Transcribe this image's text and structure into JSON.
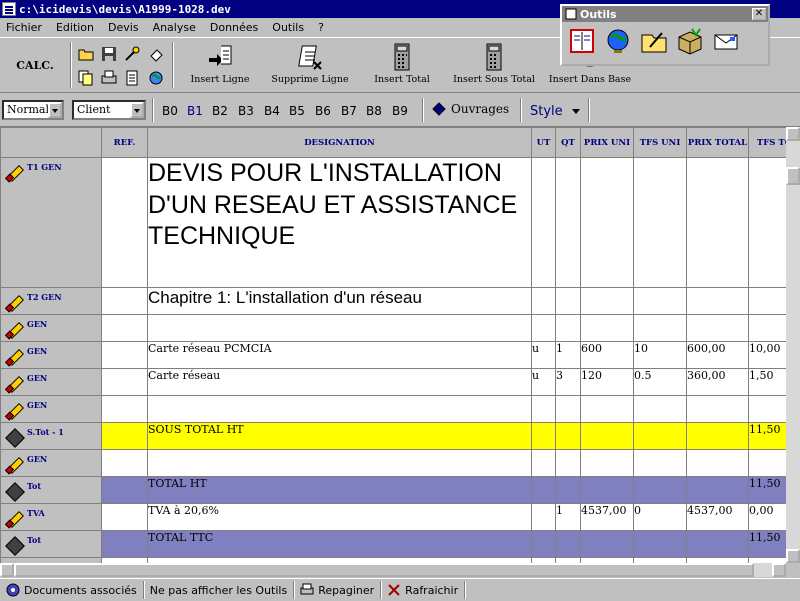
{
  "window": {
    "title": "c:\\icidevis\\devis\\A1999-1028.dev"
  },
  "menu": [
    "Fichier",
    "Edition",
    "Devis",
    "Analyse",
    "Données",
    "Outils",
    "?"
  ],
  "toolbar": {
    "calc_label": "CALC.",
    "buttons": [
      "Insert Ligne",
      "Supprime Ligne",
      "Insert Total",
      "Insert Sous Total",
      "Insert Dans Base"
    ]
  },
  "formatbar": {
    "style_value": "Normal",
    "client_value": "Client",
    "b_buttons": [
      "B0",
      "B1",
      "B2",
      "B3",
      "B4",
      "B5",
      "B6",
      "B7",
      "B8",
      "B9"
    ],
    "ouvrages_label": "Ouvrages",
    "style_label": "Style"
  },
  "columns": [
    "",
    "REF.",
    "DESIGNATION",
    "UT",
    "QT",
    "PRIX UNI",
    "TFS UNI",
    "PRIX TOTAL",
    "TFS TO"
  ],
  "rows": [
    {
      "type": "T1 GEN",
      "ref": "",
      "designation": "DEVIS POUR L'INSTALLATION D'UN RESEAU ET ASSISTANCE TECHNIQUE",
      "ut": "",
      "qt": "",
      "prix_uni": "",
      "tfs_uni": "",
      "prix_total": "",
      "tfs_total": ""
    },
    {
      "type": "T2 GEN",
      "ref": "",
      "designation": "Chapitre 1: L'installation d'un réseau",
      "ut": "",
      "qt": "",
      "prix_uni": "",
      "tfs_uni": "",
      "prix_total": "",
      "tfs_total": ""
    },
    {
      "type": "GEN",
      "ref": "",
      "designation": "",
      "ut": "",
      "qt": "",
      "prix_uni": "",
      "tfs_uni": "",
      "prix_total": "",
      "tfs_total": ""
    },
    {
      "type": "GEN",
      "ref": "",
      "designation": "Carte réseau PCMCIA",
      "ut": "u",
      "qt": "1",
      "prix_uni": "600",
      "tfs_uni": "10",
      "prix_total": "600,00",
      "tfs_total": "10,00"
    },
    {
      "type": "GEN",
      "ref": "",
      "designation": "Carte réseau",
      "ut": "u",
      "qt": "3",
      "prix_uni": "120",
      "tfs_uni": "0.5",
      "prix_total": "360,00",
      "tfs_total": "1,50"
    },
    {
      "type": "GEN",
      "ref": "",
      "designation": "",
      "ut": "",
      "qt": "",
      "prix_uni": "",
      "tfs_uni": "",
      "prix_total": "",
      "tfs_total": ""
    },
    {
      "type": "S.Tot - 1",
      "ref": "",
      "designation": "SOUS TOTAL HT",
      "ut": "",
      "qt": "",
      "prix_uni": "",
      "tfs_uni": "",
      "prix_total": "",
      "tfs_total": "11,50"
    },
    {
      "type": "GEN",
      "ref": "",
      "designation": "",
      "ut": "",
      "qt": "",
      "prix_uni": "",
      "tfs_uni": "",
      "prix_total": "",
      "tfs_total": ""
    },
    {
      "type": "Tot",
      "ref": "",
      "designation": "TOTAL HT",
      "ut": "",
      "qt": "",
      "prix_uni": "",
      "tfs_uni": "",
      "prix_total": "",
      "tfs_total": "11,50"
    },
    {
      "type": "TVA",
      "ref": "",
      "designation": "TVA à 20,6%",
      "ut": "",
      "qt": "1",
      "prix_uni": "4537,00",
      "tfs_uni": "0",
      "prix_total": "4537,00",
      "tfs_total": "0,00"
    },
    {
      "type": "Tot",
      "ref": "",
      "designation": "TOTAL TTC",
      "ut": "",
      "qt": "",
      "prix_uni": "",
      "tfs_uni": "",
      "prix_total": "",
      "tfs_total": "11,50"
    },
    {
      "type": "GEN",
      "ref": "",
      "designation": "",
      "ut": "",
      "qt": "",
      "prix_uni": "",
      "tfs_uni": "",
      "prix_total": "",
      "tfs_total": ""
    }
  ],
  "statusbar": [
    "Documents associés",
    "Ne pas afficher les Outils",
    "Repaginer",
    "Rafraichir"
  ],
  "outils_window": {
    "title": "Outils",
    "close": "✕"
  },
  "colors": {
    "subtotal_row": "#ffff00",
    "total_row": "#8080c0",
    "titlebar": "#000080"
  }
}
